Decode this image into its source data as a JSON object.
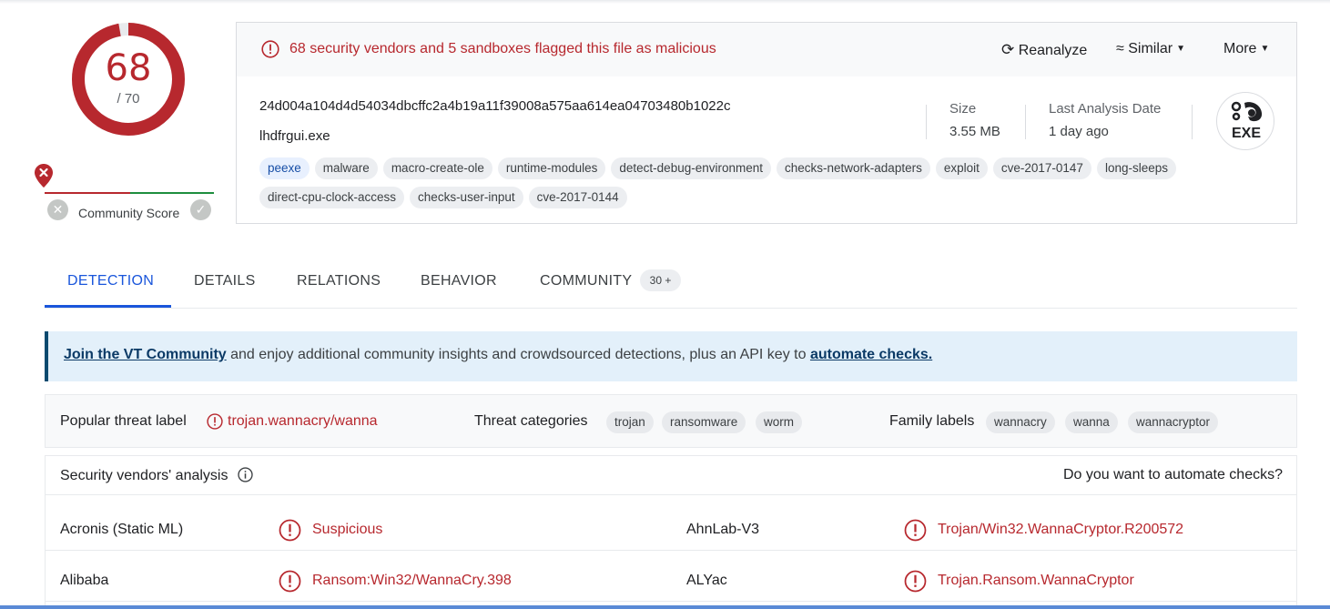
{
  "score": {
    "detections": "68",
    "total": "/ 70",
    "detection_ratio": 0.9714
  },
  "community": {
    "label": "Community Score"
  },
  "alert": {
    "message": "68 security vendors and 5 sandboxes flagged this file as malicious"
  },
  "actions": {
    "reanalyze": "Reanalyze",
    "similar": "Similar",
    "more": "More"
  },
  "file": {
    "hash": "24d004a104d4d54034dbcffc2a4b19a11f39008a575aa614ea04703480b1022c",
    "name": "lhdfrgui.exe",
    "size_label": "Size",
    "size_value": "3.55 MB",
    "date_label": "Last Analysis Date",
    "date_value": "1 day ago",
    "type_badge": "EXE"
  },
  "tags": [
    "peexe",
    "malware",
    "macro-create-ole",
    "runtime-modules",
    "detect-debug-environment",
    "checks-network-adapters",
    "exploit",
    "cve-2017-0147",
    "long-sleeps",
    "direct-cpu-clock-access",
    "checks-user-input",
    "cve-2017-0144"
  ],
  "tabs": {
    "detection": "DETECTION",
    "details": "DETAILS",
    "relations": "RELATIONS",
    "behavior": "BEHAVIOR",
    "community": "COMMUNITY",
    "community_count": "30 +"
  },
  "banner": {
    "link1": "Join the VT Community",
    "middle": " and enjoy additional community insights and crowdsourced detections, plus an API key to ",
    "link2": "automate checks."
  },
  "threat": {
    "popular_label": "Popular threat label",
    "popular_value": "trojan.wannacry/wanna",
    "categories_label": "Threat categories",
    "categories": [
      "trojan",
      "ransomware",
      "worm"
    ],
    "family_label": "Family labels",
    "families": [
      "wannacry",
      "wanna",
      "wannacryptor"
    ]
  },
  "vendors_header": {
    "title": "Security vendors' analysis",
    "automate": "Do you want to automate checks?"
  },
  "vendors": [
    {
      "left_name": "Acronis (Static ML)",
      "left_result": "Suspicious",
      "right_name": "AhnLab-V3",
      "right_result": "Trojan/Win32.WannaCryptor.R200572"
    },
    {
      "left_name": "Alibaba",
      "left_result": "Ransom:Win32/WannaCry.398",
      "right_name": "ALYac",
      "right_result": "Trojan.Ransom.WannaCryptor"
    }
  ],
  "colors": {
    "malicious": "#b7282e",
    "accent": "#1a56db",
    "banner_bg": "#e3f0fa"
  }
}
